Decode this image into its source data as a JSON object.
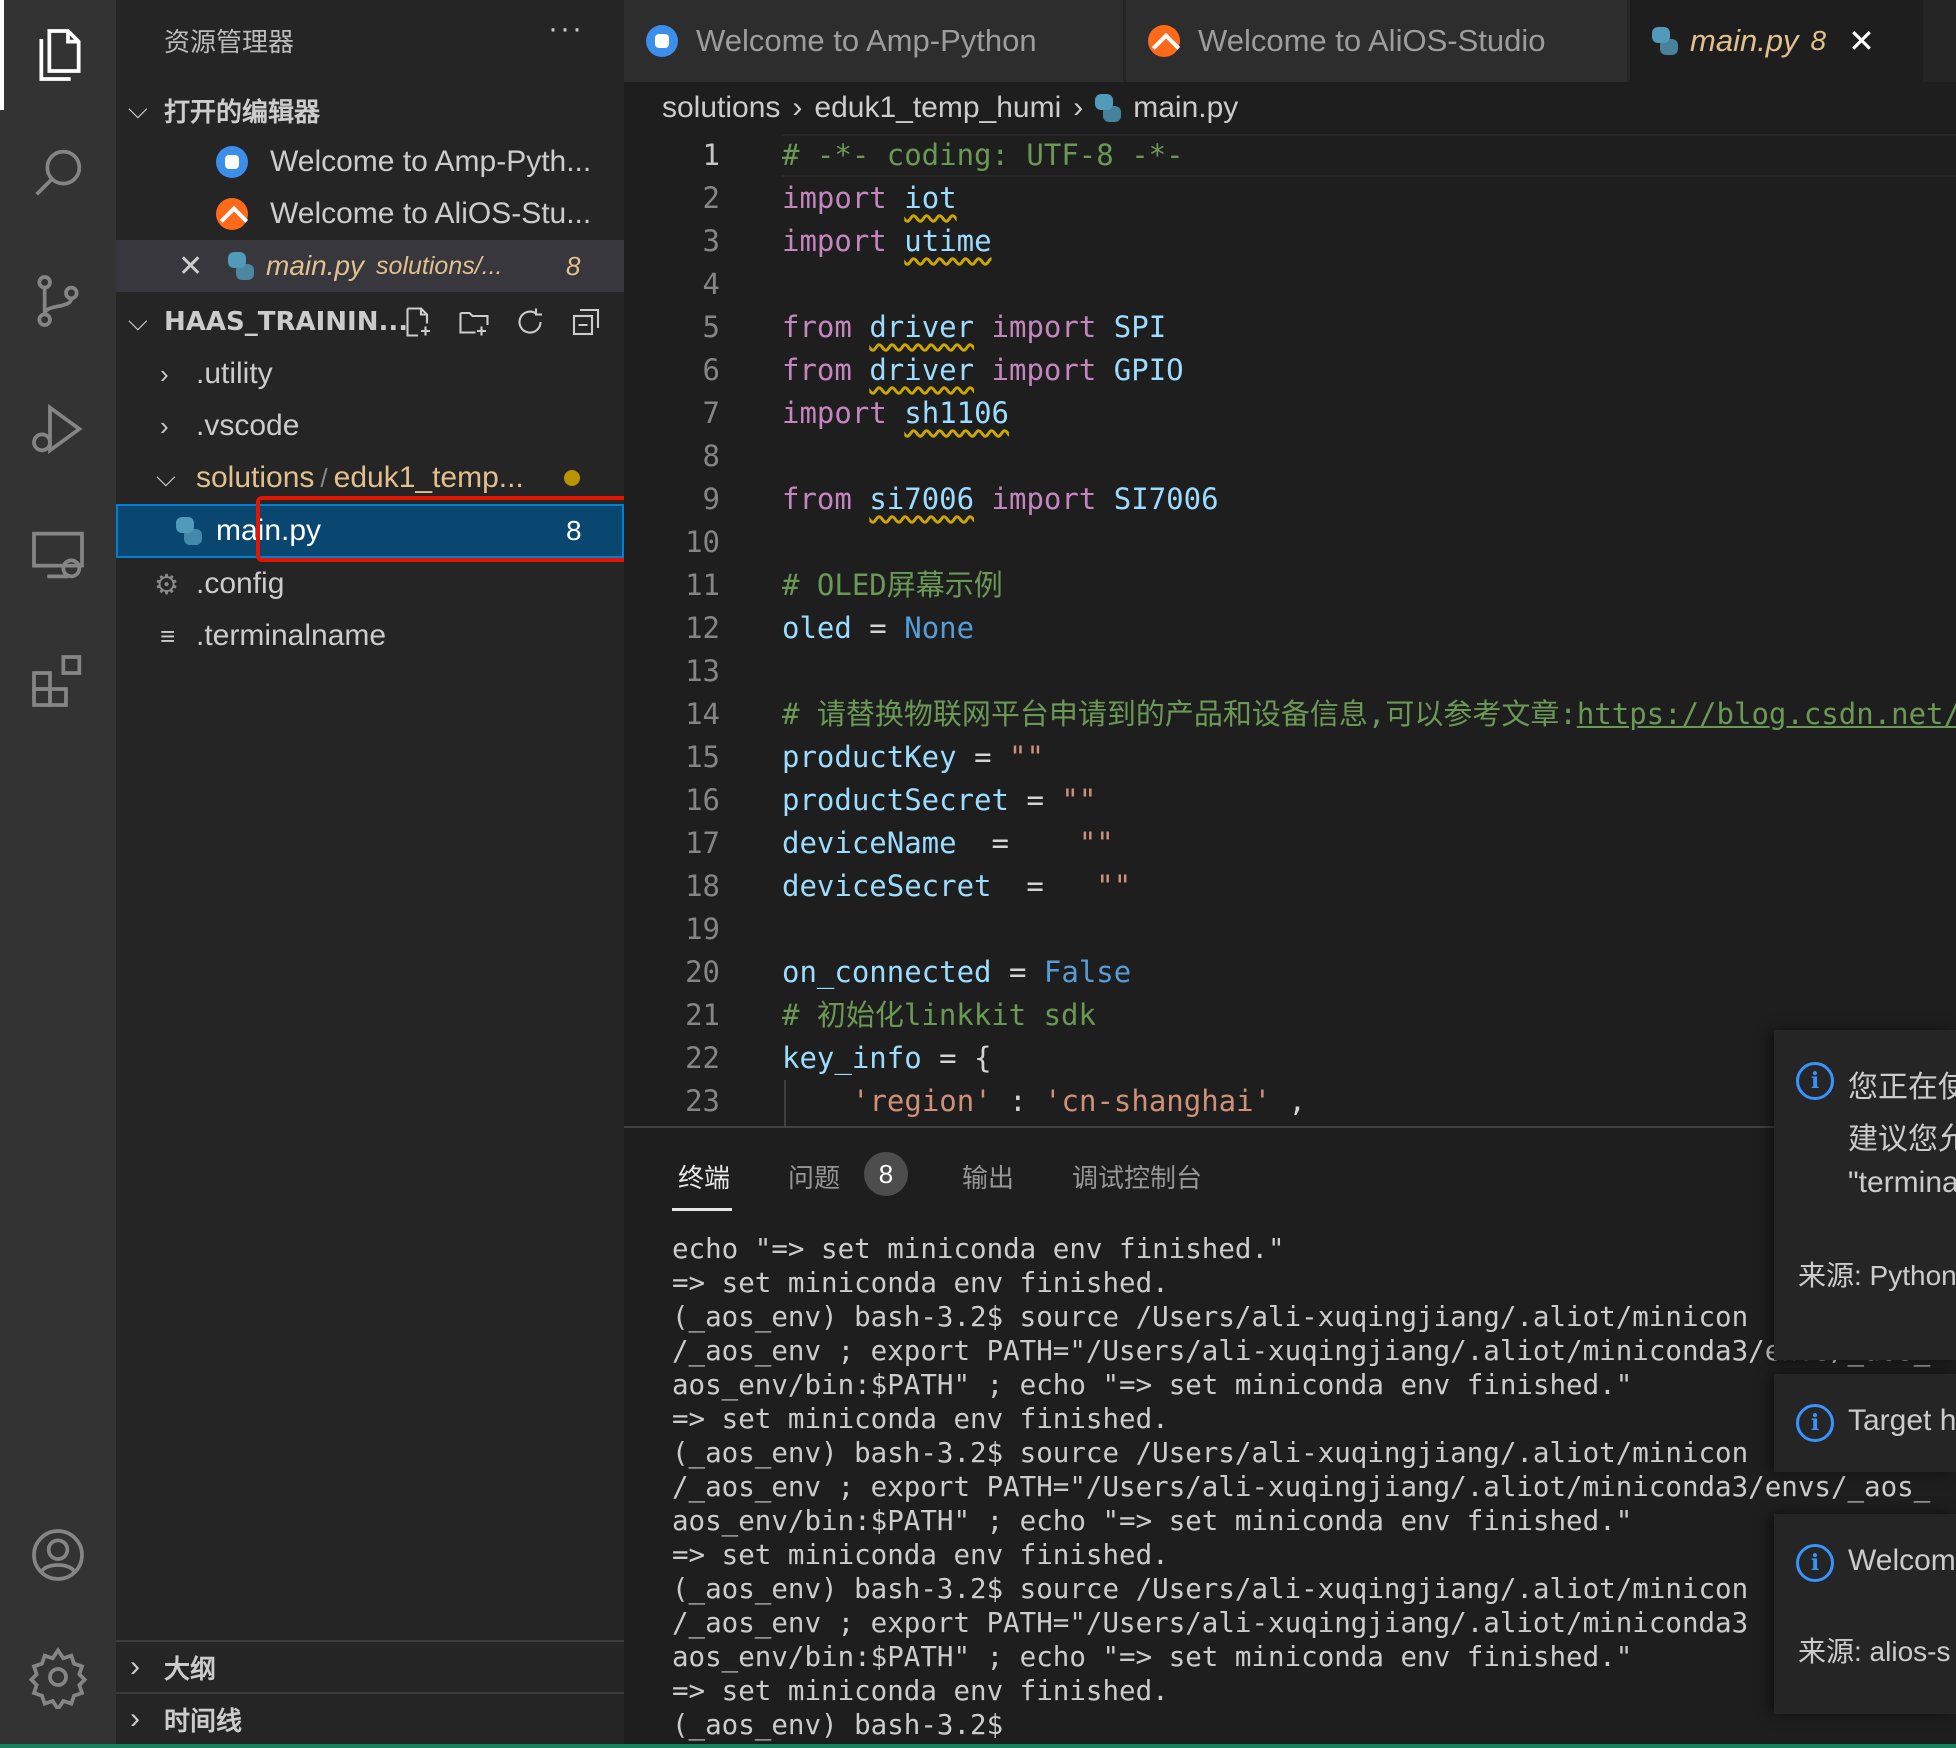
{
  "sidebar": {
    "title": "资源管理器",
    "more": "···",
    "open_editors_label": "打开的编辑器",
    "open_editors": [
      {
        "label": "Welcome to Amp-Pyth...",
        "icon": "python-icon"
      },
      {
        "label": "Welcome to AliOS-Stu...",
        "icon": "alios-icon"
      },
      {
        "label": "main.py",
        "detail": "solutions/...",
        "problems": "8",
        "icon": "python-file-icon"
      }
    ],
    "workspace_label": "HAAS_TRAININ...",
    "tree": [
      {
        "label": ".utility",
        "type": "folder"
      },
      {
        "label": ".vscode",
        "type": "folder"
      },
      {
        "label": "solutions",
        "sep": "/",
        "label2": "eduk1_temp...",
        "type": "folder-open"
      },
      {
        "label": "main.py",
        "problems": "8",
        "type": "file"
      },
      {
        "label": ".config",
        "type": "gear-file"
      },
      {
        "label": ".terminalname",
        "type": "text-file"
      }
    ],
    "outline_label": "大纲",
    "timeline_label": "时间线"
  },
  "tabs": [
    {
      "label": "Welcome to Amp-Python"
    },
    {
      "label": "Welcome to AliOS-Studio"
    },
    {
      "label": "main.py",
      "problems": "8"
    }
  ],
  "breadcrumb": [
    "solutions",
    "eduk1_temp_humi",
    "main.py"
  ],
  "editor": {
    "lines": [
      "1",
      "2",
      "3",
      "4",
      "5",
      "6",
      "7",
      "8",
      "9",
      "10",
      "11",
      "12",
      "13",
      "14",
      "15",
      "16",
      "17",
      "18",
      "19",
      "20",
      "21",
      "22",
      "23"
    ],
    "tokens": {
      "l1": "# -*- coding: UTF-8 -*-",
      "import": "import",
      "from": "from",
      "iot": "iot",
      "utime": "utime",
      "driver": "driver",
      "spi": "SPI",
      "gpio": "GPIO",
      "sh1106": "sh1106",
      "si7006": "si7006",
      "si7006_cls": "SI7006",
      "l11": "# OLED屏幕示例",
      "oled": "oled",
      "eq": " = ",
      "none": "None",
      "l14a": "# 请替换物联网平台申请到的产品和设备信息,可以参考文章:",
      "l14b": "https://blog.csdn.net/",
      "productKey": "productKey",
      "productSecret": "productSecret",
      "deviceName": "deviceName",
      "deviceSecret": "deviceSecret",
      "empty_str": "\"\"",
      "eq17": "  =    ",
      "eq18": "  =   ",
      "on_connected": "on_connected",
      "false": "False",
      "l21": "# 初始化linkkit sdk",
      "key_info": "key_info",
      "brace": " = {",
      "region": "'region'",
      "colon": " : ",
      "cn_shanghai": "'cn-shanghai'",
      "comma": " ,"
    }
  },
  "panel": {
    "tabs": [
      "终端",
      "问题",
      "输出",
      "调试控制台"
    ],
    "problems_count": "8",
    "terminal_lines": [
      "echo \"=> set miniconda env finished.\"",
      "=> set miniconda env finished.",
      "(_aos_env) bash-3.2$ source /Users/ali-xuqingjiang/.aliot/minicon",
      "/_aos_env ; export PATH=\"/Users/ali-xuqingjiang/.aliot/miniconda3/envs/_aos_",
      "aos_env/bin:$PATH\" ; echo \"=> set miniconda env finished.\"",
      "=> set miniconda env finished.",
      "(_aos_env) bash-3.2$ source /Users/ali-xuqingjiang/.aliot/minicon",
      "/_aos_env ; export PATH=\"/Users/ali-xuqingjiang/.aliot/miniconda3/envs/_aos_",
      "aos_env/bin:$PATH\" ; echo \"=> set miniconda env finished.\"",
      "=> set miniconda env finished.",
      "(_aos_env) bash-3.2$ source /Users/ali-xuqingjiang/.aliot/minicon",
      "/_aos_env ; export PATH=\"/Users/ali-xuqingjiang/.aliot/miniconda3",
      "aos_env/bin:$PATH\" ; echo \"=> set miniconda env finished.\"",
      "=> set miniconda env finished.",
      "(_aos_env) bash-3.2$"
    ]
  },
  "notifications": [
    {
      "lines": [
        "您正在使",
        "建议您允",
        "\"termina"
      ],
      "source": "来源: Python"
    },
    {
      "lines": [
        "Target h"
      ]
    },
    {
      "lines": [
        "Welcom"
      ],
      "source": "来源: alios-s"
    }
  ],
  "info_glyph": "i"
}
